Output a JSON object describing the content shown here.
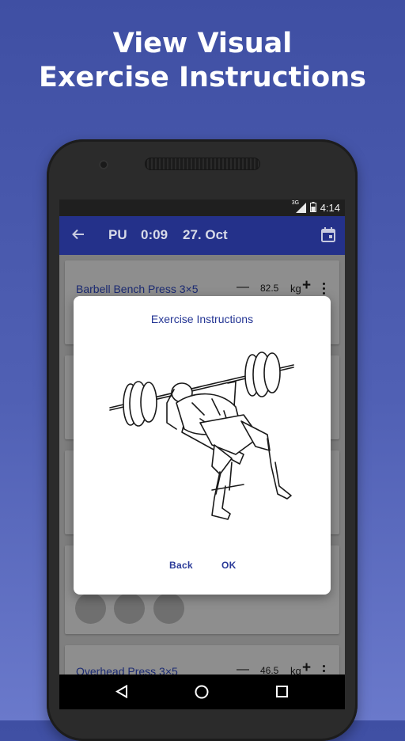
{
  "promo": {
    "headline_line1": "View Visual",
    "headline_line2": "Exercise Instructions"
  },
  "status_bar": {
    "network": "3G",
    "time": "4:14"
  },
  "app_bar": {
    "workout_code": "PU",
    "elapsed": "0:09",
    "date": "27. Oct"
  },
  "exercises": [
    {
      "name": "Barbell Bench Press 3×5",
      "weight": "82.5",
      "unit": "kg"
    },
    {
      "name": "Overhead Press 3×5",
      "weight": "46.5",
      "unit": "kg"
    }
  ],
  "dialog": {
    "title": "Exercise Instructions",
    "back_label": "Back",
    "ok_label": "OK",
    "illustration": "barbell-bench-press"
  },
  "colors": {
    "background": "#4a5aae",
    "app_bar": "#24318a",
    "accent_text": "#2a3a98"
  },
  "icons": {
    "back": "arrow-left-icon",
    "calendar": "calendar-icon",
    "nav_back": "triangle-back-icon",
    "nav_home": "circle-home-icon",
    "nav_recents": "square-recents-icon"
  }
}
